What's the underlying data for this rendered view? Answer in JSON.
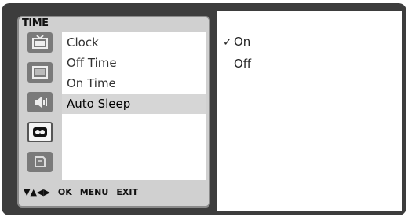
{
  "menu": {
    "title": "TIME",
    "items": [
      {
        "label": "Clock"
      },
      {
        "label": "Off Time"
      },
      {
        "label": "On Time"
      },
      {
        "label": "Auto Sleep"
      }
    ],
    "icons": [
      "tv-picture-icon",
      "screen-icon",
      "speaker-icon",
      "time-icon",
      "input-icon"
    ]
  },
  "options": [
    {
      "label": "On",
      "checked": true
    },
    {
      "label": "Off",
      "checked": false
    }
  ],
  "nav": {
    "arrows": "▼▲◀▶",
    "ok": "OK",
    "menu": "MENU",
    "exit": "EXIT"
  },
  "checkmark": "✓",
  "colors": {
    "frame": "#3d3d3d",
    "highlight": "#d6d6d6"
  }
}
